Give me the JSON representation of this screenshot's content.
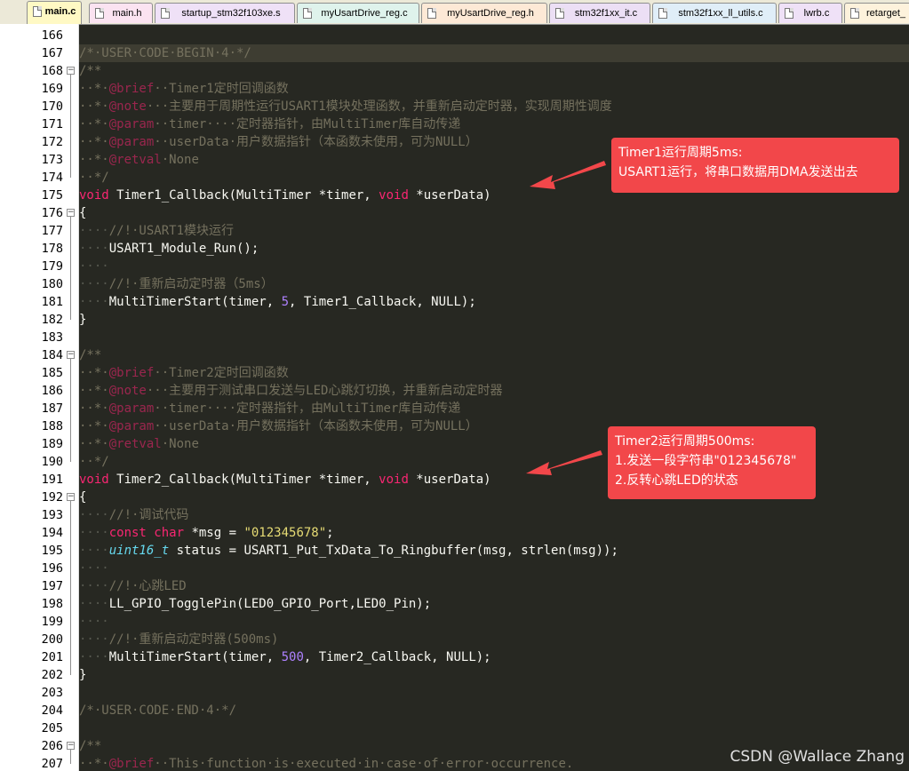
{
  "tabs": [
    {
      "label": "main.c",
      "color": "#fff9c4",
      "active": true
    },
    {
      "label": "main.h",
      "color": "#fbe3f1"
    },
    {
      "label": "startup_stm32f103xe.s",
      "color": "#efe1f7"
    },
    {
      "label": "myUsartDrive_reg.c",
      "color": "#dff3ec"
    },
    {
      "label": "myUsartDrive_reg.h",
      "color": "#fde9d6"
    },
    {
      "label": "stm32f1xx_it.c",
      "color": "#ecdff5"
    },
    {
      "label": "stm32f1xx_ll_utils.c",
      "color": "#e0eef8"
    },
    {
      "label": "lwrb.c",
      "color": "#efe1f7"
    },
    {
      "label": "retarget_",
      "color": "#fdf2dc"
    }
  ],
  "editor": {
    "current_line": 167,
    "lines": [
      {
        "n": 166,
        "fold": "",
        "html": ""
      },
      {
        "n": 167,
        "fold": "",
        "html": "<span class=\"cm\">/*·USER·CODE·BEGIN·4·*/</span>"
      },
      {
        "n": 168,
        "fold": "-",
        "html": "<span class=\"cm\">/**</span>"
      },
      {
        "n": 169,
        "fold": "",
        "html": "<span class=\"cm\">··*·<span class=\"tag\">@brief</span>··Timer1定时回调函数</span>"
      },
      {
        "n": 170,
        "fold": "",
        "html": "<span class=\"cm\">··*·<span class=\"tag\">@note</span>···主要用于周期性运行USART1模块处理函数，并重新启动定时器，实现周期性调度</span>"
      },
      {
        "n": 171,
        "fold": "",
        "html": "<span class=\"cm\">··*·<span class=\"tag\">@param</span>··timer····定时器指针，由MultiTimer库自动传递</span>"
      },
      {
        "n": 172,
        "fold": "",
        "html": "<span class=\"cm\">··*·<span class=\"tag\">@param</span>··userData·用户数据指针（本函数未使用，可为NULL）</span>"
      },
      {
        "n": 173,
        "fold": "",
        "html": "<span class=\"cm\">··*·<span class=\"tag\">@retval</span>·None</span>"
      },
      {
        "n": 174,
        "fold": "",
        "html": "<span class=\"cm\">··*/</span>"
      },
      {
        "n": 175,
        "fold": "",
        "html": "<span class=\"kw\">void</span> Timer1_Callback(MultiTimer *timer, <span class=\"kw\">void</span> *userData)"
      },
      {
        "n": 176,
        "fold": "-",
        "html": "{"
      },
      {
        "n": 177,
        "fold": "",
        "html": "<span class=\"ws\">····</span><span class=\"cm\">//!·USART1模块运行</span>"
      },
      {
        "n": 178,
        "fold": "",
        "html": "<span class=\"ws\">····</span>USART1_Module_Run();"
      },
      {
        "n": 179,
        "fold": "",
        "html": "<span class=\"ws\">····</span>"
      },
      {
        "n": 180,
        "fold": "",
        "html": "<span class=\"ws\">····</span><span class=\"cm\">//!·重新启动定时器（5ms）</span>"
      },
      {
        "n": 181,
        "fold": "",
        "html": "<span class=\"ws\">····</span>MultiTimerStart(timer, <span class=\"num\">5</span>, Timer1_Callback, NULL);"
      },
      {
        "n": 182,
        "fold": "",
        "html": "}"
      },
      {
        "n": 183,
        "fold": "",
        "html": ""
      },
      {
        "n": 184,
        "fold": "-",
        "html": "<span class=\"cm\">/**</span>"
      },
      {
        "n": 185,
        "fold": "",
        "html": "<span class=\"cm\">··*·<span class=\"tag\">@brief</span>··Timer2定时回调函数</span>"
      },
      {
        "n": 186,
        "fold": "",
        "html": "<span class=\"cm\">··*·<span class=\"tag\">@note</span>···主要用于测试串口发送与LED心跳灯切换，并重新启动定时器</span>"
      },
      {
        "n": 187,
        "fold": "",
        "html": "<span class=\"cm\">··*·<span class=\"tag\">@param</span>··timer····定时器指针，由MultiTimer库自动传递</span>"
      },
      {
        "n": 188,
        "fold": "",
        "html": "<span class=\"cm\">··*·<span class=\"tag\">@param</span>··userData·用户数据指针（本函数未使用，可为NULL）</span>"
      },
      {
        "n": 189,
        "fold": "",
        "html": "<span class=\"cm\">··*·<span class=\"tag\">@retval</span>·None</span>"
      },
      {
        "n": 190,
        "fold": "",
        "html": "<span class=\"cm\">··*/</span>"
      },
      {
        "n": 191,
        "fold": "",
        "html": "<span class=\"kw\">void</span> Timer2_Callback(MultiTimer *timer, <span class=\"kw\">void</span> *userData)"
      },
      {
        "n": 192,
        "fold": "-",
        "html": "{"
      },
      {
        "n": 193,
        "fold": "",
        "html": "<span class=\"ws\">····</span><span class=\"cm\">//!·调试代码</span>"
      },
      {
        "n": 194,
        "fold": "",
        "html": "<span class=\"ws\">····</span><span class=\"kw\">const char</span> *msg = <span class=\"str\">\"012345678\"</span>;"
      },
      {
        "n": 195,
        "fold": "",
        "html": "<span class=\"ws\">····</span><span class=\"typ\">uint16_t</span> status = USART1_Put_TxData_To_Ringbuffer(msg, strlen(msg));"
      },
      {
        "n": 196,
        "fold": "",
        "html": "<span class=\"ws\">····</span>"
      },
      {
        "n": 197,
        "fold": "",
        "html": "<span class=\"ws\">····</span><span class=\"cm\">//!·心跳LED</span>"
      },
      {
        "n": 198,
        "fold": "",
        "html": "<span class=\"ws\">····</span>LL_GPIO_TogglePin(LED0_GPIO_Port,LED0_Pin);"
      },
      {
        "n": 199,
        "fold": "",
        "html": "<span class=\"ws\">····</span>"
      },
      {
        "n": 200,
        "fold": "",
        "html": "<span class=\"ws\">····</span><span class=\"cm\">//!·重新启动定时器(500ms)</span>"
      },
      {
        "n": 201,
        "fold": "",
        "html": "<span class=\"ws\">····</span>MultiTimerStart(timer, <span class=\"num\">500</span>, Timer2_Callback, NULL);"
      },
      {
        "n": 202,
        "fold": "",
        "html": "}"
      },
      {
        "n": 203,
        "fold": "",
        "html": ""
      },
      {
        "n": 204,
        "fold": "",
        "html": "<span class=\"cm\">/*·USER·CODE·END·4·*/</span>"
      },
      {
        "n": 205,
        "fold": "",
        "html": ""
      },
      {
        "n": 206,
        "fold": "-",
        "html": "<span class=\"cm\">/**</span>"
      },
      {
        "n": 207,
        "fold": "",
        "html": "<span class=\"cm\">··*·<span class=\"tag\">@brief</span>··This·function·is·executed·in·case·of·error·occurrence.</span>"
      }
    ]
  },
  "callouts": [
    {
      "lines": [
        "Timer1运行周期5ms:",
        "USART1运行，将串口数据用DMA发送出去"
      ]
    },
    {
      "lines": [
        "Timer2运行周期500ms:",
        "1.发送一段字符串\"012345678\"",
        "2.反转心跳LED的状态"
      ]
    }
  ],
  "watermark": "CSDN @Wallace Zhang",
  "colors": {
    "editor_bg": "#272822",
    "callout_bg": "#f2474a",
    "keyword": "#f92672",
    "comment": "#75715e",
    "string": "#e6db74",
    "number": "#ae81ff"
  }
}
